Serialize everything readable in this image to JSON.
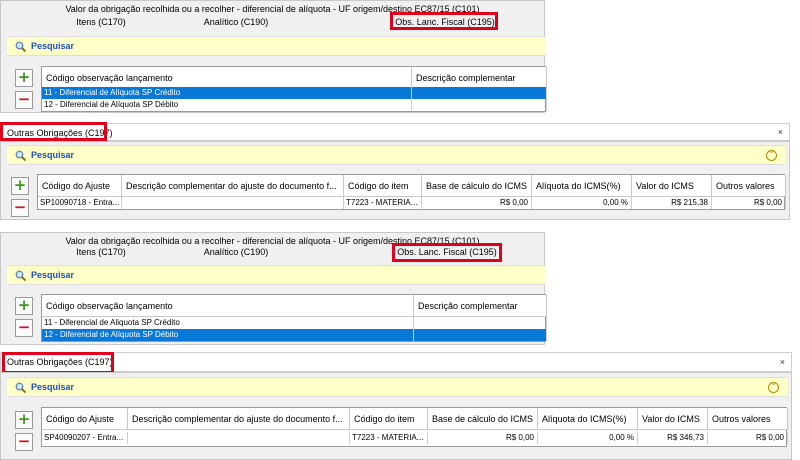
{
  "panel1": {
    "header": "Valor da obrigação recolhida ou a recolher - diferencial de alíquota - UF origem/destino EC87/15 (C101)",
    "tabs": [
      "Itens (C170)",
      "Analítico (C190)",
      "Obs. Lanc. Fiscal (C195)"
    ],
    "search_label": "Pesquisar",
    "columns": [
      "Código observação lançamento",
      "Descrição complementar"
    ],
    "rows": [
      {
        "code": "11 - Diferencial de Alíquota SP Crédito",
        "desc": "",
        "selected": true
      },
      {
        "code": "12 - Diferencial de Alíquota SP Débito",
        "desc": "",
        "selected": false
      }
    ]
  },
  "section1": {
    "title": "Outras Obrigações (C197)",
    "close": "×",
    "search_label": "Pesquisar",
    "columns": [
      "Código do Ajuste",
      "Descrição complementar do ajuste do documento f...",
      "Código do item",
      "Base de cálculo do ICMS",
      "Alíquota do ICMS(%)",
      "Valor do ICMS",
      "Outros valores"
    ],
    "row": [
      "SP10090718 - Entra...",
      "",
      "T7223 - MATERIA...",
      "R$ 0,00",
      "0,00 %",
      "R$ 215,38",
      "R$ 0,00"
    ]
  },
  "panel2": {
    "header": "Valor da obrigação recolhida ou a recolher - diferencial de alíquota - UF origem/destino EC87/15 (C101)",
    "tabs": [
      "Itens (C170)",
      "Analítico (C190)",
      "Obs. Lanc. Fiscal (C195)"
    ],
    "search_label": "Pesquisar",
    "columns": [
      "Código observação lançamento",
      "Descrição complementar"
    ],
    "rows": [
      {
        "code": "11 - Diferencial de Aliquota SP Crédito",
        "desc": "",
        "selected": false
      },
      {
        "code": "12 - Diferencial de Alíquota SP Débito",
        "desc": "",
        "selected": true
      }
    ]
  },
  "section2": {
    "title": "Outras Obrigações (C197)",
    "close": "×",
    "search_label": "Pesquisar",
    "columns": [
      "Código do Ajuste",
      "Descrição complementar do ajuste do documento f...",
      "Código do item",
      "Base de cálculo do ICMS",
      "Alíquota do ICMS(%)",
      "Valor do ICMS",
      "Outros valores"
    ],
    "row": [
      "SP40090207 - Entra...",
      "",
      "T7223 - MATERIA...",
      "R$ 0,00",
      "0,00 %",
      "R$ 346,73",
      "R$ 0,00"
    ]
  },
  "icons": {
    "search": "magnifier-icon",
    "add": "plus-icon",
    "remove": "minus-icon",
    "expand": "double-chevron-down-icon",
    "close": "close-icon"
  },
  "colors": {
    "highlight": "#e0001b",
    "selection": "#0a78d7",
    "search_bg": "#ffffc8",
    "add": "#3a9b1a",
    "remove": "#d0141b"
  }
}
